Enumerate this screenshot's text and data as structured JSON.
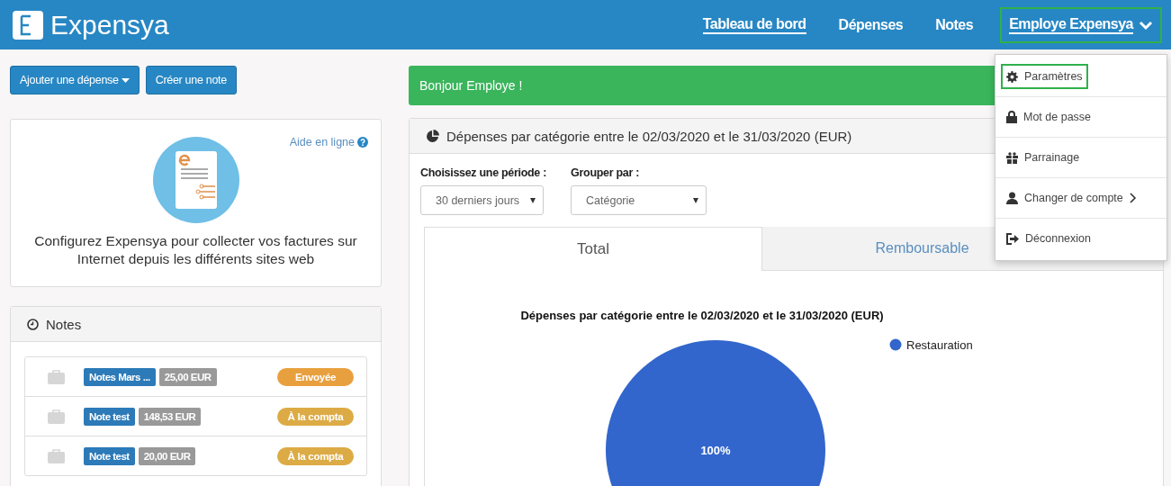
{
  "brand": {
    "name": "Expensya"
  },
  "nav": [
    {
      "label": "Tableau de bord",
      "selected": true,
      "highlighted": false
    },
    {
      "label": "Dépenses",
      "selected": false,
      "highlighted": false
    },
    {
      "label": "Notes",
      "selected": false,
      "highlighted": false
    },
    {
      "label": "Employe Expensya",
      "selected": true,
      "highlighted": true,
      "kind": "dropdown"
    }
  ],
  "user_menu": [
    {
      "label": "Paramètres",
      "highlighted": true,
      "submenu": false
    },
    {
      "label": "Mot de passe",
      "highlighted": false,
      "submenu": false
    },
    {
      "label": "Parrainage",
      "highlighted": false,
      "submenu": false
    },
    {
      "label": "Changer de compte",
      "highlighted": false,
      "submenu": true
    },
    {
      "label": "Déconnexion",
      "highlighted": false,
      "submenu": false
    }
  ],
  "actions": [
    {
      "label": "Ajouter une dépense",
      "caret": true
    },
    {
      "label": "Créer une note",
      "caret": false
    }
  ],
  "help_card": {
    "link": "Aide en ligne",
    "text": "Configurez Expensya pour collecter vos factures sur Internet depuis les différents sites web"
  },
  "notes_panel": {
    "title": "Notes",
    "rows": [
      {
        "name": "Notes Mars ...",
        "amount": "25,00 EUR",
        "status": "Envoyée",
        "color": "#e8a03f"
      },
      {
        "name": "Note test",
        "amount": "148,53 EUR",
        "status": "À la compta",
        "color": "#dcab45"
      },
      {
        "name": "Note test",
        "amount": "20,00 EUR",
        "status": "À la compta",
        "color": "#dcab45"
      }
    ]
  },
  "alert": {
    "text": "Bonjour Employe !"
  },
  "chart_panel": {
    "title": "Dépenses par catégorie entre le 02/03/2020 et le 31/03/2020 (EUR)",
    "period": {
      "label": "Choisissez une période :",
      "value": "30 derniers jours"
    },
    "group_by": {
      "label": "Grouper par :",
      "value": "Catégorie"
    },
    "tabs": [
      {
        "label": "Total",
        "selected": true
      },
      {
        "label": "Remboursable",
        "selected": false
      }
    ],
    "chart_data": {
      "type": "pie",
      "title": "Dépenses par catégorie entre le 02/03/2020 et le 31/03/2020 (EUR)",
      "categories": [
        "Restauration"
      ],
      "values": [
        100
      ],
      "value_labels": [
        "100%"
      ]
    }
  }
}
